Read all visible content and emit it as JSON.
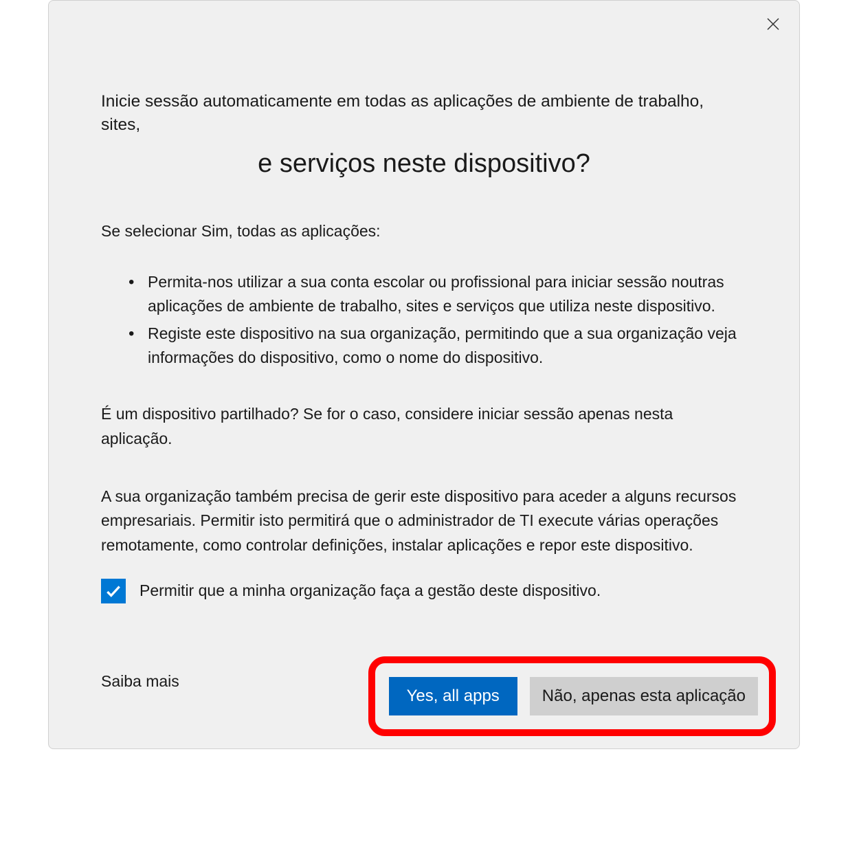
{
  "heading": {
    "line1": "Inicie sessão automaticamente em todas as aplicações de ambiente de trabalho, sites,",
    "line2": "e serviços neste dispositivo?"
  },
  "subheading": "Se selecionar Sim, todas as aplicações:",
  "bullets": [
    "Permita-nos utilizar a sua conta escolar ou profissional para iniciar sessão noutras aplicações de ambiente de trabalho, sites e serviços que utiliza neste dispositivo.",
    "Registe este dispositivo na sua organização, permitindo que a sua organização veja informações do dispositivo, como o nome do dispositivo."
  ],
  "shared_device_text": "É um dispositivo partilhado? Se for o caso, considere iniciar sessão apenas nesta aplicação.",
  "org_manage_text": "A sua organização também precisa de gerir este dispositivo para aceder a alguns recursos empresariais. Permitir isto permitirá que o administrador de TI execute várias operações remotamente, como controlar definições, instalar aplicações e repor este dispositivo.",
  "checkbox": {
    "label": "Permitir que a minha organização faça a gestão deste dispositivo.",
    "checked": true
  },
  "learn_more": "Saiba mais",
  "buttons": {
    "primary": "Yes, all apps",
    "secondary": "Não, apenas esta aplicação"
  }
}
